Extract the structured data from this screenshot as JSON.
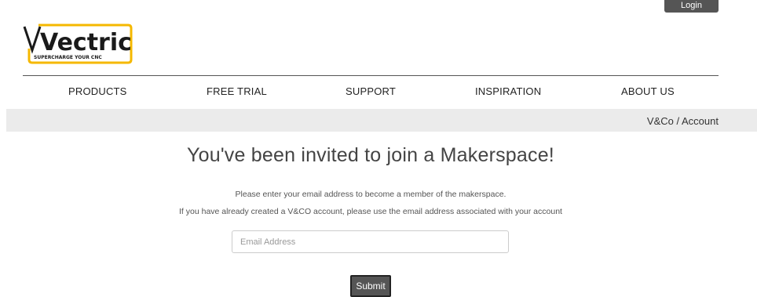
{
  "header": {
    "login_label": "Login",
    "logo": {
      "wordmark": "Vectric",
      "tagline": "SUPERCHARGE YOUR CNC",
      "accent_color": "#f5b800"
    }
  },
  "nav": {
    "items": [
      {
        "label": "PRODUCTS"
      },
      {
        "label": "FREE TRIAL"
      },
      {
        "label": "SUPPORT"
      },
      {
        "label": "INSPIRATION"
      },
      {
        "label": "ABOUT US"
      }
    ]
  },
  "breadcrumb": {
    "first": "V&Co",
    "separator": " / ",
    "second": "Account"
  },
  "main": {
    "headline": "You've been invited to join a Makerspace!",
    "line1": "Please enter your email address to become a member of the makerspace.",
    "line2": "If you have already created a V&CO account, please use the email address associated with your account",
    "email_placeholder": "Email Address",
    "submit_label": "Submit"
  }
}
